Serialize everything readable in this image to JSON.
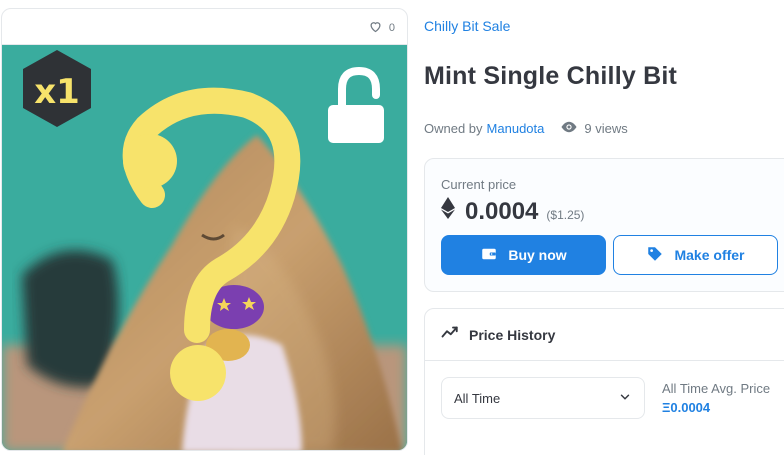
{
  "item_card": {
    "favorite_count": "0",
    "edition_badge": "x1",
    "question_mark": "?"
  },
  "item": {
    "collection": "Chilly Bit Sale",
    "title": "Mint Single Chilly Bit",
    "owned_by_label": "Owned by",
    "owner": "Manudota",
    "views": "9 views"
  },
  "price": {
    "label": "Current price",
    "amount": "0.0004",
    "usd": "($1.25)",
    "buy_label": "Buy now",
    "offer_label": "Make offer"
  },
  "history": {
    "title": "Price History",
    "range_selected": "All Time",
    "avg_label": "All Time Avg. Price",
    "avg_value": "Ξ0.0004"
  },
  "icons": {
    "favorite": "heart-outline-icon",
    "views": "eye-icon",
    "currency": "ethereum-icon",
    "buy": "wallet-icon",
    "offer": "tag-icon",
    "history": "trending-line-icon",
    "dropdown": "chevron-down-icon"
  },
  "colors": {
    "accent": "#2081e2",
    "art_background": "#3aac9e",
    "question_mark": "#f7e36b",
    "text_primary": "#353840",
    "text_secondary": "#707a83"
  }
}
